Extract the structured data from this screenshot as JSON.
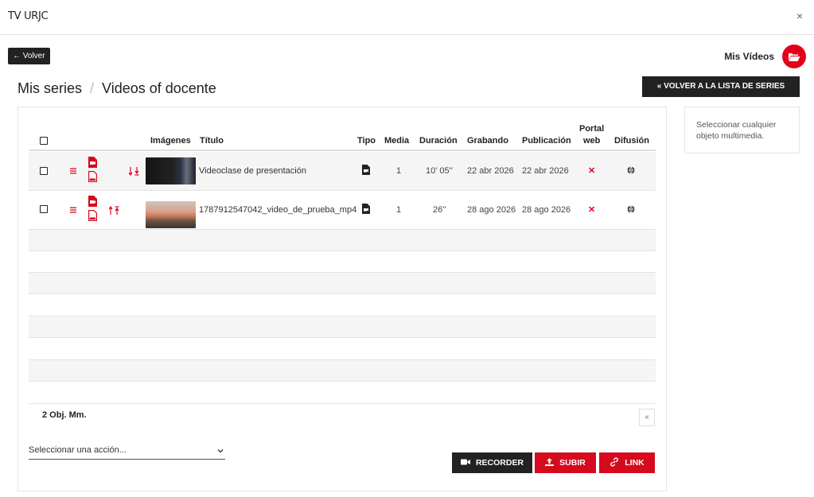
{
  "app": {
    "title": "TV URJC",
    "close": "×"
  },
  "nav": {
    "back_label": "← Volver",
    "mis_videos_label": "Mis Vídeos"
  },
  "breadcrumb": {
    "root": "Mis series",
    "separator": "/",
    "current": "Videos of docente"
  },
  "actions": {
    "back_to_series": "« VOLVER A LA LISTA DE SERIES"
  },
  "side_panel": {
    "hint": "Seleccionar cualquier objeto multimedia."
  },
  "table": {
    "headers": {
      "images": "Imágenes",
      "title": "Título",
      "type": "Tipo",
      "media": "Media",
      "duration": "Duración",
      "recorded": "Grabando",
      "published": "Publicación",
      "portal_line1": "Portal",
      "portal_line2": "web",
      "broadcast": "Difusión"
    },
    "rows": [
      {
        "title": "Videoclase de presentación",
        "media": "1",
        "duration": "10' 05''",
        "recorded": "22 abr 2026",
        "published": "22 abr 2026",
        "portal": "✕",
        "sort_icon": "move-down-bottom-icon"
      },
      {
        "title": "1787912547042_video_de_prueba_mp4",
        "media": "1",
        "duration": "26''",
        "recorded": "28 ago 2026",
        "published": "28 ago 2026",
        "portal": "✕",
        "sort_icon": "move-up-top-icon"
      }
    ],
    "count_label": "2 Obj. Mm.",
    "pager_label": "«"
  },
  "bottom": {
    "select_placeholder": "Seleccionar una acción...",
    "recorder_label": "RECORDER",
    "upload_label": "SUBIR",
    "link_label": "LINK"
  },
  "colors": {
    "accent": "#e4001b",
    "dark": "#222222",
    "button_red": "#d60a1d"
  }
}
